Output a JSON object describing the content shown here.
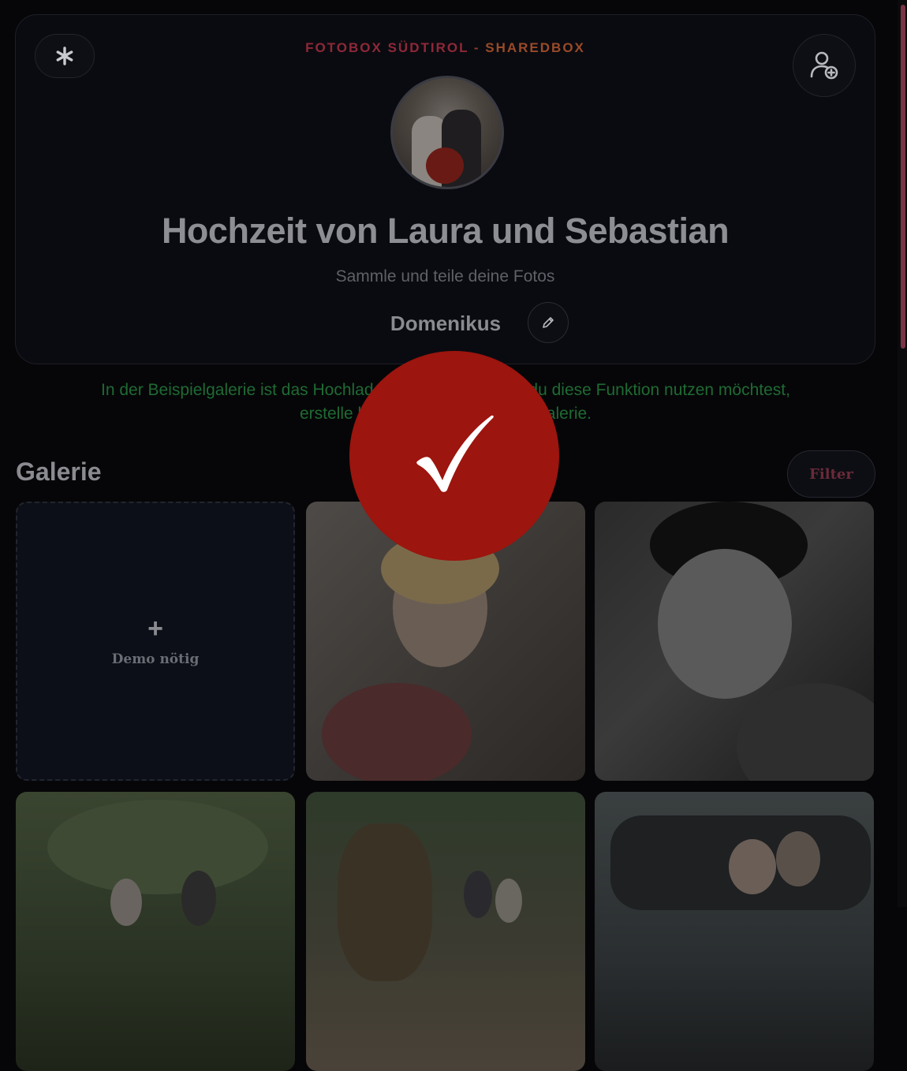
{
  "header": {
    "brand_part1": "FOTOBOX SÜDTIROL",
    "brand_sep": " - ",
    "brand_part2": "SHAREDBOX",
    "title": "Hochzeit von Laura und Sebastian",
    "subtitle": "Sammle und teile deine Fotos",
    "username": "Domenikus",
    "icons": {
      "menu": "asterisk-icon",
      "invite": "add-user-icon",
      "edit": "pencil-icon"
    }
  },
  "notice": {
    "line1": "In der Beispielgalerie ist das Hochladen deaktiviert. Wenn du diese Funktion nutzen möchtest,",
    "line2": "erstelle bitte eine eigene Demo-Galerie."
  },
  "gallery": {
    "title": "Galerie",
    "filter_label": "Filter",
    "upload_tile_label": "Demo nötig",
    "upload_tile_icon": "plus-icon"
  },
  "overlay": {
    "icon": "checkmark-icon",
    "color": "#9c150e"
  },
  "colors": {
    "accent": "#8f2838",
    "notice": "#1f6a33",
    "background": "#060608"
  }
}
